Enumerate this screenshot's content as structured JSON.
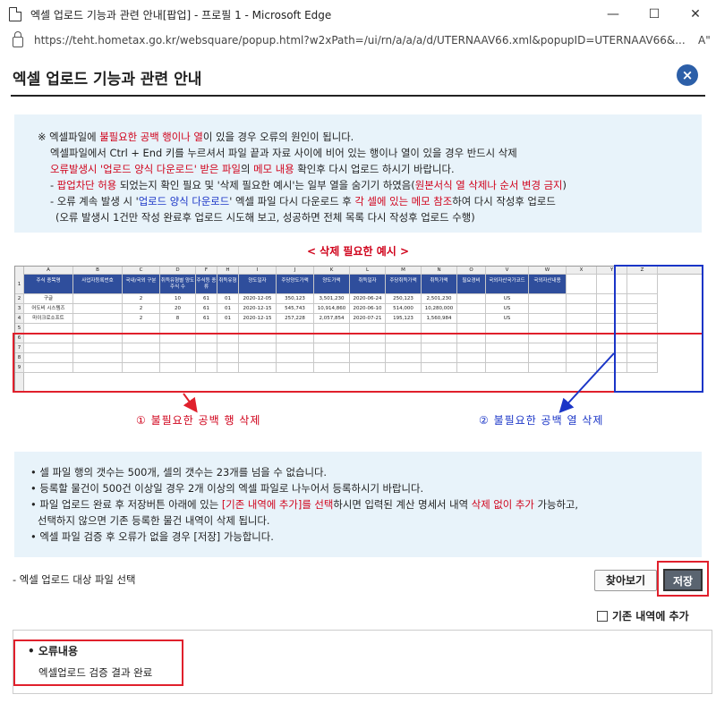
{
  "window": {
    "title": "엑셀 업로드 기능과 관련 안내[팝업] - 프로필 1 - Microsoft Edge",
    "minimize": "—",
    "maximize": "☐",
    "close": "✕",
    "url": "https://teht.hometax.go.kr/websquare/popup.html?w2xPath=/ui/rn/a/a/a/d/UTERNAAV66.xml&popupID=UTERNAAV66&...",
    "reader_icon": "A\""
  },
  "header": {
    "title": "엑셀 업로드 기능과 관련 안내",
    "close_icon": "×"
  },
  "notice": {
    "l1_a": "※ 엑셀파일에 ",
    "l1_b": "불필요한 공백 행이나 열",
    "l1_c": "이 있을 경우 오류의 원인이 됩니다.",
    "l2": "엑셀파일에서 Ctrl + End 키를 누르셔서 파일 끝과 자료 사이에 비어 있는 행이나 열이 있을 경우 반드시 삭제",
    "l3_a": "오류발생시 '업로드 양식 다운로드' 받은 파일",
    "l3_b": "의 ",
    "l3_c": "메모 내용",
    "l3_d": " 확인후 다시 업로드 하시기 바랍니다.",
    "l4_a": "- ",
    "l4_b": "팝업차단 허용",
    "l4_c": " 되었는지 확인 필요 및 '삭제 필요한 예시'는 일부 열을 숨기기 하였음(",
    "l4_d": "원본서식 열 삭제나 순서 변경 금지",
    "l4_e": ")",
    "l5_a": "- 오류 계속 발생 시 '",
    "l5_b": "업로드 양식 다운로드",
    "l5_c": "' 엑셀 파일 다시 다운로드 후 ",
    "l5_d": "각 셀에 있는 메모 참조",
    "l5_e": "하여 다시 작성후 업로드",
    "l6": "(오류 발생시 1건만 작성 완료후 업로드 시도해 보고, 성공하면 전체 목록 다시 작성후 업로드 수행)"
  },
  "example": {
    "title": "< 삭제 필요한 예시 >",
    "col_letters": [
      "A",
      "B",
      "C",
      "D",
      "F",
      "H",
      "I",
      "J",
      "K",
      "L",
      "M",
      "N",
      "O",
      "V",
      "W",
      "X",
      "Y",
      "Z"
    ],
    "row_numbers": [
      "1",
      "2",
      "3",
      "4",
      "5",
      "6",
      "7",
      "8",
      "9"
    ],
    "headers": [
      "주식 종목명",
      "사업자등록번호",
      "국내/국외 구분",
      "취득유형별 양도주식 수",
      "주식등 종류",
      "취득유형",
      "양도일자",
      "주당양도가액",
      "양도가액",
      "취득일자",
      "주당취득가액",
      "취득가액",
      "필요경비",
      "국외자산국가코드",
      "국외자산내용",
      "",
      "",
      ""
    ],
    "rows": [
      [
        "구글",
        "",
        "2",
        "10",
        "61",
        "01",
        "2020-12-05",
        "350,123",
        "3,501,230",
        "2020-06-24",
        "250,123",
        "2,501,230",
        "",
        "US",
        "",
        "",
        "",
        ""
      ],
      [
        "어도비 시스템즈",
        "",
        "2",
        "20",
        "61",
        "01",
        "2020-12-15",
        "545,743",
        "10,914,860",
        "2020-06-10",
        "514,000",
        "10,280,000",
        "",
        "US",
        "",
        "",
        "",
        ""
      ],
      [
        "마이크로소프트",
        "",
        "2",
        "8",
        "61",
        "01",
        "2020-12-15",
        "257,228",
        "2,057,854",
        "2020-07-21",
        "195,123",
        "1,560,984",
        "",
        "US",
        "",
        "",
        "",
        ""
      ]
    ],
    "label_rows": "① 불필요한 공백 행 삭제",
    "label_cols": "② 불필요한 공백 열 삭제"
  },
  "info": {
    "i1": "• 셀 파일 행의 갯수는 500개, 셀의 갯수는 23개를 넘을 수 없습니다.",
    "i2": "• 등록할 물건이 500건 이상일 경우 2개 이상의 엑셀 파일로 나누어서 등록하시기 바랍니다.",
    "i3_a": "• 파일 업로드 완료 후 저장버튼 아래에 있는 ",
    "i3_b": "[기존 내역에 추가]를 선택",
    "i3_c": "하시면 입력된 계산 명세서 내역 ",
    "i3_d": "삭제 없이 추가",
    "i3_e": " 가능하고,",
    "i4": "선택하지 않으면 기존 등록한 물건 내역이 삭제 됩니다.",
    "i5": "• 엑셀 파일 검증 후 오류가 없을 경우 [저장] 가능합니다."
  },
  "upload": {
    "label": "- 엑셀 업로드 대상 파일 선택",
    "find_button": "찾아보기",
    "save_button": "저장",
    "append_checkbox": "기존 내역에 추가"
  },
  "error": {
    "title": "• 오류내용",
    "value": "엑셀업로드 검증 결과 완료"
  },
  "colors": {
    "accent_red": "#e0202c",
    "accent_blue": "#1a35c7",
    "panel_bg": "#e8f3fa",
    "close_bg": "#2c5fa8"
  }
}
